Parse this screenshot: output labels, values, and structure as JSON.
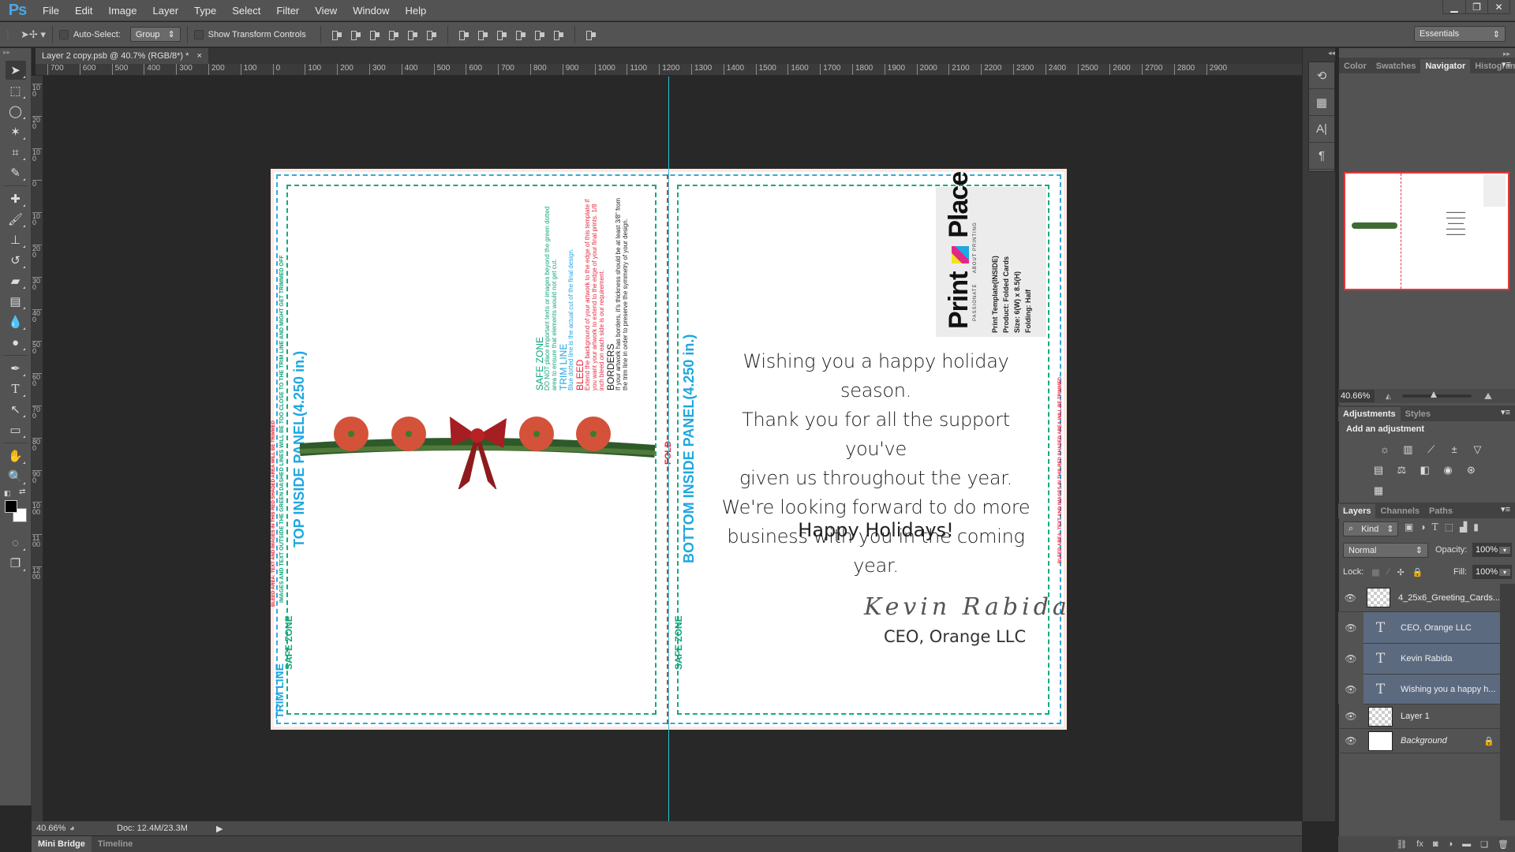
{
  "app": {
    "logo": "Ps"
  },
  "menu": [
    "File",
    "Edit",
    "Image",
    "Layer",
    "Type",
    "Select",
    "Filter",
    "View",
    "Window",
    "Help"
  ],
  "window_controls": [
    "minimize",
    "restore",
    "close"
  ],
  "options_bar": {
    "auto_select_label": "Auto-Select:",
    "auto_select_value": "Group",
    "show_transform_label": "Show Transform Controls",
    "workspace": "Essentials"
  },
  "document_tab": {
    "title": "Layer 2 copy.psb @ 40.7% (RGB/8*) *",
    "close": "×"
  },
  "ruler_top": [
    "700",
    "600",
    "500",
    "400",
    "300",
    "200",
    "100",
    "0",
    "100",
    "200",
    "300",
    "400",
    "500",
    "600",
    "700",
    "800",
    "900",
    "1000",
    "1100",
    "1200",
    "1300",
    "1400",
    "1500",
    "1600",
    "1700",
    "1800",
    "1900",
    "2000",
    "2100",
    "2200",
    "2300",
    "2400",
    "2500",
    "2600",
    "2700",
    "2800",
    "2900"
  ],
  "ruler_left": [
    "100",
    "200",
    "100",
    "0",
    "100",
    "200",
    "300",
    "400",
    "500",
    "600",
    "700",
    "800",
    "900",
    "1000",
    "1100",
    "1200"
  ],
  "card": {
    "top_panel_label": "TOP INSIDE PANEL(4.250 in.)",
    "bottom_panel_label": "BOTTOM INSIDE PANEL(4.250 in.)",
    "trim_line_label": "TRIM LINE",
    "safe_zone_label": "SAFE ZONE",
    "fold_label": "FOLD",
    "safe_zone_warning": "IMAGES AND TEXT OUTSIDE THE GREEN DASHED LINES WILL BE TOO CLOSE TO THE TRIM LINE AND MIGHT GET TRIMMED OFF",
    "bleed_warning": "BLEED AREA: TEXT AND IMAGES IN THIS RED SHADED AREA WILL BE TRIMMED",
    "info": [
      {
        "heading": "SAFE ZONE",
        "body": "DO NOT place important texts or images beyond the green dotted area to ensure that elements would not get cut.",
        "color": "#0fa57a"
      },
      {
        "heading": "TRIM LINE",
        "body": "Blue dotted line is the actual cut of the final design.",
        "color": "#1ea7e0"
      },
      {
        "heading": "BLEED",
        "body": "Extend the background of your artwork to the edge of this template if you want your artwork to extend to the edge of your final prints. 1/8 inch bleed on each side is our requirement.",
        "color": "#e6273f"
      },
      {
        "heading": "BORDERS",
        "body": "If your artwork has borders, it's thickness should be at least 3/8\" from the trim line in order to preserve the symmetry of your design.",
        "color": "#222222"
      }
    ],
    "logo": {
      "word1": "Print",
      "word2": "Place",
      "tagline_left": "PASSIONATE",
      "tagline_right": "ABOUT PRINTING"
    },
    "template_info": [
      "Print Template(INSIDE)",
      "Product: Folded Cards",
      "Size: 6(W) x 8.5(H)",
      "Folding: Half"
    ],
    "greeting_lines": [
      "Wishing you a happy holiday season.",
      "Thank you for all the support you've",
      "given us throughout the year.",
      "We're looking forward to do more",
      "business with you in the coming year."
    ],
    "closing": "Happy Holidays!",
    "signature": "Kevin Rabida",
    "signature_title": "CEO, Orange LLC"
  },
  "panels": {
    "top_tabs": [
      "Color",
      "Swatches",
      "Navigator",
      "Histogram"
    ],
    "active_top_tab": "Navigator",
    "navigator_zoom": "40.66%",
    "adjust_tabs": [
      "Adjustments",
      "Styles"
    ],
    "add_adjustment": "Add an adjustment",
    "layers_tabs": [
      "Layers",
      "Channels",
      "Paths"
    ],
    "filter_kind": "Kind",
    "blend_mode": "Normal",
    "opacity_label": "Opacity:",
    "opacity_value": "100%",
    "lock_label": "Lock:",
    "fill_label": "Fill:",
    "fill_value": "100%",
    "layers": [
      {
        "name": "4_25x6_Greeting_Cards...",
        "type": "smart",
        "selected": false
      },
      {
        "name": "CEO, Orange LLC",
        "type": "text",
        "selected": true
      },
      {
        "name": "Kevin Rabida",
        "type": "text",
        "selected": true
      },
      {
        "name": "Wishing you a happy h...",
        "type": "text",
        "selected": true
      },
      {
        "name": "Layer 1",
        "type": "pixel",
        "selected": false
      },
      {
        "name": "Background",
        "type": "background",
        "selected": false,
        "locked": true
      }
    ]
  },
  "status": {
    "zoom": "40.66%",
    "doc": "Doc: 12.4M/23.3M"
  },
  "bottom_tabs": [
    "Mini Bridge",
    "Timeline"
  ],
  "colors": {
    "accent_selected_layer": "#5c6a80",
    "guide": "#29c4d3",
    "trim": "#33aadd",
    "safe": "#16a981",
    "bleed": "#e5324b"
  }
}
